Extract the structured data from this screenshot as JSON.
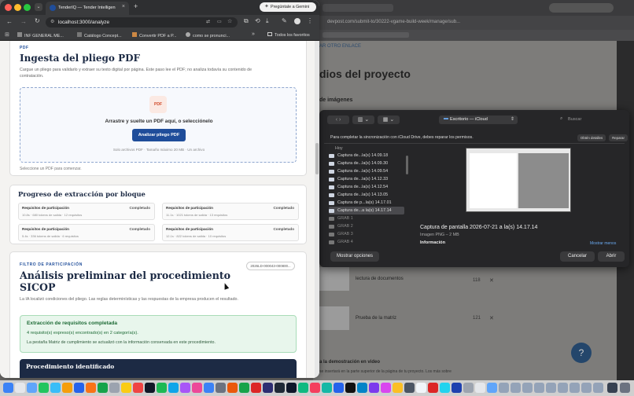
{
  "front_browser": {
    "tab_title": "TenderIQ — Tender Intelligen",
    "gemini_button": "Pregúntale a Gemini",
    "url": "localhost:3000/analyze",
    "bookmarks": [
      "INF GENERAL ME...",
      "Catálogo Concept...",
      "Convertir PDF a P...",
      "como se pronunci..."
    ],
    "bookmarks_more": "»",
    "all_bookmarks": "Todos los favoritos"
  },
  "pdf_section": {
    "eyebrow": "PDF",
    "title": "Ingesta del pliego PDF",
    "description": "Cargue un pliego para validarlo y extraer su texto digital por página. Este paso lee el PDF; no analiza todavía su contenido de contratación.",
    "file_badge": "PDF",
    "drop_text": "Arrastre y suelte un PDF aquí, o selecciónelo",
    "analyze_button": "Analizar pliego PDF",
    "hint": "Solo archivos PDF · Tamaño máximo 20 MB · Un archivo",
    "footer": "Seleccione un PDF para comenzar."
  },
  "progress_section": {
    "title": "Progreso de extracción por bloque",
    "blocks": [
      {
        "title": "Requisitos de participación",
        "status": "Completado",
        "sub": "10.8s · 680 tokens de salida · 12 requisitos"
      },
      {
        "title": "Requisitos de participación",
        "status": "Completado",
        "sub": "11.1s · 1021 tokens de salida · 13 requisitos"
      },
      {
        "title": "Requisitos de participación",
        "status": "Completado",
        "sub": "5.4s · 336 tokens de salida · 6 requisitos"
      },
      {
        "title": "Requisitos de participación",
        "status": "Completado",
        "sub": "12.1s · 822 tokens de salida · 10 requisitos"
      }
    ]
  },
  "filter_section": {
    "eyebrow": "FILTRO DE PARTICIPACIÓN",
    "badge": "2026LD-000043-000800...",
    "title_line1": "Análisis preliminar del procedimiento",
    "title_line2": "SICOP",
    "description": "La IA localizó condiciones del pliego. Las reglas determinísticas y las respuestas de la empresa producen el resultado.",
    "success_title": "Extracción de requisitos completada",
    "success_line1": "4 requisito(s) expreso(s) encontrado(s) en 2 categoría(s).",
    "success_line2": "La pestaña Matriz de cumplimiento se actualizó con la información conservada en este procedimiento.",
    "identified_title": "Procedimiento identificado"
  },
  "back_browser": {
    "url": "devpost.com/submit-to/30222-vgame-build-week/manage/sub...",
    "link_text": "AR OTRO ENLACE",
    "heading": "dios del proyecto",
    "subheading": "de imágenes",
    "rows": [
      {
        "name": "lectura de documentos",
        "size": "118"
      },
      {
        "name": "Prueba de la matriz",
        "size": "121"
      }
    ],
    "footer_title": "a la demostración en video",
    "footer_text": "se insertará en la parte superior de la página de tu proyecto. Los más sobre",
    "help": "?"
  },
  "file_dialog": {
    "location": "Escritorio — iCloud",
    "search_placeholder": "Buscar",
    "notice": "Para completar la sincronización con iCloud Drive, debes reparar los permisos.",
    "details_button": "Obtén detalles",
    "repair_button": "Reparar",
    "section_today": "Hoy",
    "files": [
      "Captura de...la(s) 14.09.18",
      "Captura de...la(s) 14.09.30",
      "Captura de...la(s) 14.09.54",
      "Captura de...la(s) 14.12.33",
      "Captura de...la(s) 14.12.54",
      "Captura de...la(s) 14.13.05",
      "Captura de p...la(s) 14.17.01",
      "Captura de...a la(s) 14.17.14",
      "GRAB 1",
      "GRAB 2",
      "GRAB 3",
      "GRAB 4"
    ],
    "selected_index": 7,
    "preview_name": "Captura de pantalla 2026-07-21 a la(s) 14.17.14",
    "preview_type": "Imagen PNG – 2 MB",
    "info_label": "Información",
    "show_less": "Mostrar menos",
    "options_button": "Mostrar opciones",
    "cancel_button": "Cancelar",
    "open_button": "Abrir"
  },
  "colors": {
    "navy": "#1c2a44",
    "primary_button": "#1f4d9a",
    "success_bg": "#e8f6ec",
    "success_text": "#1e6b36"
  }
}
